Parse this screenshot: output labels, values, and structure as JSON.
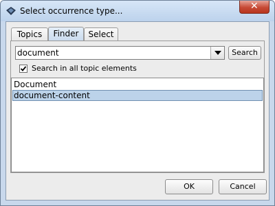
{
  "window": {
    "title": "Select occurrence type..."
  },
  "tabs": [
    {
      "label": "Topics",
      "active": false
    },
    {
      "label": "Finder",
      "active": true
    },
    {
      "label": "Select",
      "active": false
    }
  ],
  "finder": {
    "search_value": "document",
    "search_button_label": "Search",
    "checkbox_label": "Search in all topic elements",
    "checkbox_checked": true,
    "results": [
      {
        "label": "Document",
        "selected": false
      },
      {
        "label": "document-content",
        "selected": true
      }
    ]
  },
  "footer": {
    "ok_label": "OK",
    "cancel_label": "Cancel"
  },
  "colors": {
    "selection": "#bcd3ea",
    "close_button": "#c74a35"
  }
}
